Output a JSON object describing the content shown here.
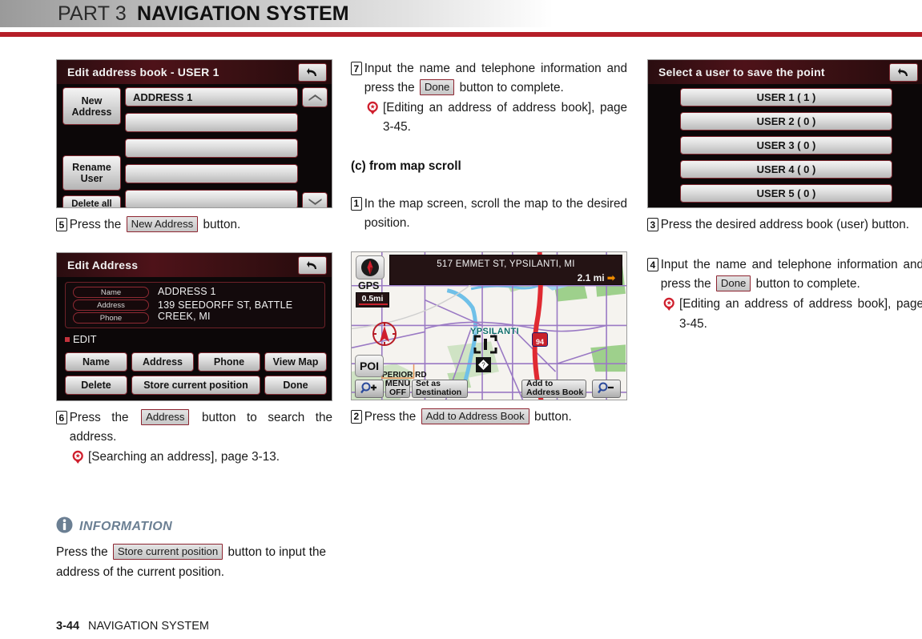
{
  "header": {
    "part_label": "PART 3",
    "title": "NAVIGATION SYSTEM",
    "accent_color": "#b51e28"
  },
  "footer": {
    "page": "3-44",
    "section": "NAVIGATION SYSTEM"
  },
  "left_column": {
    "screen_edit_address_book": {
      "title": "Edit address book - USER 1",
      "back_icon": "back-arrow-icon",
      "side_buttons": [
        "New Address",
        "Rename User",
        "Delete all"
      ],
      "list_rows": [
        "ADDRESS 1",
        "",
        "",
        "",
        ""
      ],
      "scroll_up_icon": "chevron-up-icon",
      "scroll_down_icon": "chevron-down-icon"
    },
    "step5": {
      "num": "5",
      "before": "Press the",
      "button": "New Address",
      "after": "button."
    },
    "screen_edit_address": {
      "title": "Edit Address",
      "back_icon": "back-arrow-icon",
      "fields": [
        {
          "label": "Name",
          "value": "ADDRESS 1"
        },
        {
          "label": "Address",
          "value": "139 SEEDORFF ST, BATTLE CREEK, MI"
        },
        {
          "label": "Phone",
          "value": ""
        }
      ],
      "edit_label": "EDIT",
      "buttons_row1": [
        "Name",
        "Address",
        "Phone",
        "View Map"
      ],
      "buttons_row2": [
        "Delete",
        "Store current position",
        "Done"
      ]
    },
    "step6": {
      "num": "6",
      "before": "Press the",
      "button": "Address",
      "after": "button to search the address.",
      "ref": "[Searching an address], page 3-13."
    },
    "information": {
      "icon": "info-icon",
      "title": "INFORMATION",
      "before": "Press the",
      "button": "Store current position",
      "after": "button to input the address of the current position."
    }
  },
  "middle_column": {
    "step7": {
      "num": "7",
      "before": "Input the name and telephone information and press the",
      "button": "Done",
      "after": "button to complete.",
      "ref": "[Editing an address of address book], page 3-45."
    },
    "subhead": "(c) from map scroll",
    "step1": {
      "num": "1",
      "text": "In the map screen, scroll the map to the desired position."
    },
    "map_screen": {
      "compass_icon": "compass-icon",
      "gps_label": "GPS",
      "scale_label": "0.5mi",
      "banner_address": "517 EMMET ST, YPSILANTI, MI",
      "banner_distance": "2.1 mi",
      "banner_arrow_icon": "arrow-right-icon",
      "poi_button": "POI",
      "poi_icon": "chevron-down-icon",
      "zoom_in_icon": "magnifier-plus-icon",
      "zoom_out_icon": "magnifier-minus-icon",
      "menu_off_line1": "MENU",
      "menu_off_line2": "OFF",
      "set_dest_line1": "Set as",
      "set_dest_line2": "Destination",
      "add_book_line1": "Add to",
      "add_book_line2": "Address Book",
      "city_label": "YPSILANTI",
      "road_label": "PERIOR RD",
      "interstate_label": "94",
      "cursor_icon": "map-cursor-icon",
      "vehicle_icon": "vehicle-position-icon",
      "poi_marker_icon": "poi-marker-icon"
    },
    "step2": {
      "num": "2",
      "before": "Press the",
      "button": "Add to Address Book",
      "after": "button."
    }
  },
  "right_column": {
    "screen_select_user": {
      "title": "Select a user to save the point",
      "back_icon": "back-arrow-icon",
      "rows": [
        "USER 1 ( 1 )",
        "USER 2 ( 0 )",
        "USER 3 ( 0 )",
        "USER 4 ( 0 )",
        "USER 5 ( 0 )"
      ]
    },
    "step3": {
      "num": "3",
      "text": "Press the desired address book (user) button."
    },
    "step4": {
      "num": "4",
      "before": "Input the name and telephone information and press the",
      "button": "Done",
      "after": "button to complete.",
      "ref": "[Editing an address of address book], page 3-45."
    }
  }
}
